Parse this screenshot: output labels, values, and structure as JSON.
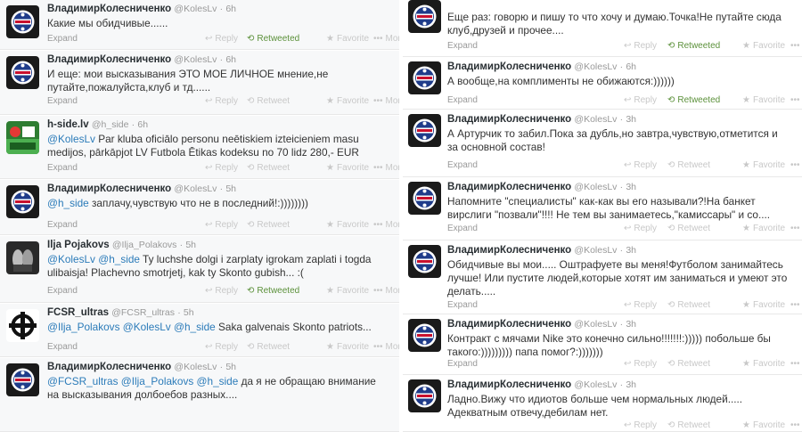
{
  "colors": {
    "mention": "#2b7bb9",
    "retweeted": "#5c913b",
    "muted": "#999999",
    "action": "#c8c8c8"
  },
  "labels": {
    "expand": "Expand",
    "reply": "Reply",
    "retweet": "Retweet",
    "retweeted": "Retweeted",
    "favorite": "Favorite",
    "more": "More",
    "dot": "·"
  },
  "left_tweets": [
    {
      "avatar": "club-crest",
      "name": "ВладимирКолесниченко",
      "handle": "@KolesLv",
      "time": "6h",
      "text": [
        {
          "t": "Какие мы обидчивые......"
        }
      ],
      "retweeted": true
    },
    {
      "avatar": "club-crest",
      "name": "ВладимирКолесниченко",
      "handle": "@KolesLv",
      "time": "6h",
      "text": [
        {
          "t": "И еще: мои высказывания ЭТО МОЕ ЛИЧНОЕ мнение,не путайте,пожалуйста,клуб и тд......"
        }
      ],
      "retweeted": false
    },
    {
      "avatar": "h-side-logo",
      "name": "h-side.lv",
      "handle": "@h_side",
      "time": "6h",
      "text": [
        {
          "t": "@KolesLv",
          "m": true
        },
        {
          "t": " Par kluba oficiālo personu neētiskiem izteicieniem masu medijos, pārkāpjot LV Futbola Ētikas kodeksu no 70 lidz 280,- EUR"
        }
      ],
      "retweeted": false
    },
    {
      "avatar": "club-crest",
      "name": "ВладимирКолесниченко",
      "handle": "@KolesLv",
      "time": "5h",
      "text": [
        {
          "t": "@h_side",
          "m": true
        },
        {
          "t": " заплачу,чувствую что не в последний!:))))))))"
        }
      ],
      "retweeted": false
    },
    {
      "avatar": "hands-photo",
      "name": "Ilja Pojakovs",
      "handle": "@Ilja_Polakovs",
      "time": "5h",
      "text": [
        {
          "t": "@KolesLv",
          "m": true
        },
        {
          "t": " "
        },
        {
          "t": "@h_side",
          "m": true
        },
        {
          "t": " Ty luchshe dolgi i zarplaty igrokam zaplati i togda ulibaisja! Plachevno smotrjetj, kak ty Skonto gubish... :("
        }
      ],
      "retweeted": true
    },
    {
      "avatar": "celtic-cross",
      "name": "FCSR_ultras",
      "handle": "@FCSR_ultras",
      "time": "5h",
      "text": [
        {
          "t": "@Ilja_Polakovs",
          "m": true
        },
        {
          "t": " "
        },
        {
          "t": "@KolesLv",
          "m": true
        },
        {
          "t": " "
        },
        {
          "t": "@h_side",
          "m": true
        },
        {
          "t": " Saka galvenais Skonto patriots..."
        }
      ],
      "retweeted": false
    },
    {
      "avatar": "club-crest",
      "name": "ВладимирКолесниченко",
      "handle": "@KolesLv",
      "time": "5h",
      "text": [
        {
          "t": "@FCSR_ultras",
          "m": true
        },
        {
          "t": " "
        },
        {
          "t": "@Ilja_Polakovs",
          "m": true
        },
        {
          "t": " "
        },
        {
          "t": "@h_side",
          "m": true
        },
        {
          "t": " да я не обращаю внимание на высказывания долбоебов разных...."
        }
      ],
      "retweeted": false,
      "no_actions": true
    }
  ],
  "right_tweets": [
    {
      "avatar": "club-crest",
      "name": "ВладимирКолесниченко",
      "handle": "@KolesLv",
      "time": "6h",
      "text": [
        {
          "t": "Еще раз: говорю и пишу то что хочу и думаю.Точка!Не путайте сюда клуб,друзей и прочее...."
        }
      ],
      "retweeted": true,
      "no_head": true
    },
    {
      "avatar": "club-crest",
      "name": "ВладимирКолесниченко",
      "handle": "@KolesLv",
      "time": "6h",
      "text": [
        {
          "t": "А вообще,на комплименты не обижаются:))))))"
        }
      ],
      "retweeted": true
    },
    {
      "avatar": "club-crest",
      "name": "ВладимирКолесниченко",
      "handle": "@KolesLv",
      "time": "3h",
      "text": [
        {
          "t": "А Артурчик то забил.Пока за дубль,но завтра,чувствую,отметится и за основной состав!"
        }
      ],
      "retweeted": false
    },
    {
      "avatar": "club-crest",
      "name": "ВладимирКолесниченко",
      "handle": "@KolesLv",
      "time": "3h",
      "text": [
        {
          "t": "Напомните \"специалисты\" как-как вы его называли?!На банкет вирслиги \"позвали\"!!!! Не тем вы занимаетесь,\"камиссары\" и со...."
        }
      ],
      "retweeted": false
    },
    {
      "avatar": "club-crest",
      "name": "ВладимирКолесниченко",
      "handle": "@KolesLv",
      "time": "3h",
      "text": [
        {
          "t": "Обидчивые вы мои..... Оштрафуете вы меня!Футболом занимайтесь лучше! Или пустите людей,которые хотят им заниматься и умеют это делать....."
        }
      ],
      "retweeted": false
    },
    {
      "avatar": "club-crest",
      "name": "ВладимирКолесниченко",
      "handle": "@KolesLv",
      "time": "3h",
      "text": [
        {
          "t": "Контракт с мячами Nike это конечно сильно!!!!!!!:))))) побольше бы такого:))))))))) папа помог?:)))))))"
        }
      ],
      "retweeted": false
    },
    {
      "avatar": "club-crest",
      "name": "ВладимирКолесниченко",
      "handle": "@KolesLv",
      "time": "3h",
      "text": [
        {
          "t": "Ладно.Вижу что идиотов больше чем нормальных людей..... Адекватным отвечу,дебилам нет."
        }
      ],
      "retweeted": false,
      "no_expand": true
    }
  ]
}
